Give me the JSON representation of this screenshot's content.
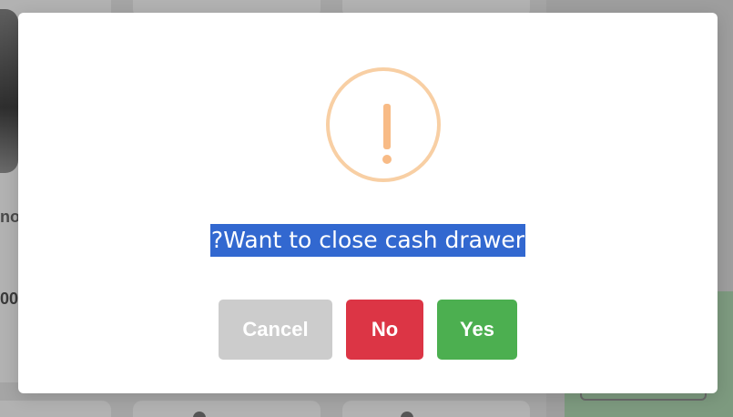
{
  "background": {
    "partial_texts": [
      "no",
      "00"
    ]
  },
  "dialog": {
    "icon": "exclamation-warning-icon",
    "message": "Want to close cash drawer?",
    "buttons": {
      "cancel_label": "Cancel",
      "no_label": "No",
      "yes_label": "Yes"
    }
  },
  "colors": {
    "cancel": "#cccccc",
    "no": "#dc3545",
    "yes": "#4caf50",
    "warning": "#f8bb86",
    "selection": "#3268d0"
  }
}
